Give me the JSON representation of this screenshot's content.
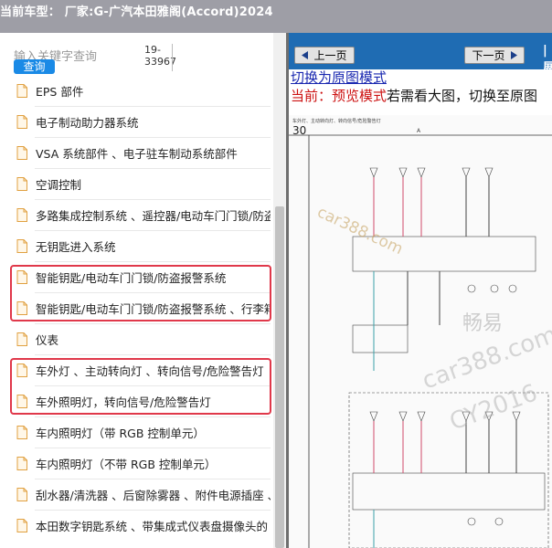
{
  "titlebar": {
    "text": "当前车型： 厂家:G-广汽本田雅阁(Accord)2024"
  },
  "search": {
    "placeholder": "输入关键字查询",
    "button": "查询",
    "code_line1": "19-",
    "code_line2": "33967"
  },
  "tree": {
    "items": [
      {
        "label": "EPS 部件"
      },
      {
        "label": "电子制动助力器系统"
      },
      {
        "label": "VSA 系统部件 、电子驻车制动系统部件"
      },
      {
        "label": "空调控制"
      },
      {
        "label": "多路集成控制系统 、遥控器/电动车门门锁/防盗"
      },
      {
        "label": "无钥匙进入系统"
      },
      {
        "label": "智能钥匙/电动车门门锁/防盗报警系统"
      },
      {
        "label": "智能钥匙/电动车门门锁/防盗报警系统 、行李箱"
      },
      {
        "label": "仪表"
      },
      {
        "label": "车外灯 、主动转向灯 、转向信号/危险警告灯"
      },
      {
        "label": "车外照明灯，转向信号/危险警告灯"
      },
      {
        "label": "车内照明灯（带 RGB 控制单元）"
      },
      {
        "label": "车内照明灯（不带 RGB 控制单元）"
      },
      {
        "label": "刮水器/清洗器 、后窗除雾器 、附件电源插座 、"
      },
      {
        "label": "本田数字钥匙系统 、带集成式仪表盘摄像头的"
      }
    ]
  },
  "nav": {
    "prev": "上一页",
    "next": "下一页",
    "edge": "|展"
  },
  "viewer": {
    "switch_link": "切换为原图模式",
    "mode_label": "当前：预览模式",
    "mode_hint": "若需看大图，切换至原图",
    "page_number": "30",
    "diagram_title": "车外灯、主动转向灯、转向信号/危险警告灯",
    "grid_letter": "A",
    "watermarks": [
      "car388.com",
      "畅易",
      "car388.com",
      "CY2016"
    ]
  },
  "colors": {
    "nav_bg": "#1f6cb3",
    "highlight": "#e0384a",
    "search_btn": "#1a8ae6",
    "link": "#1a28b0",
    "mode_red": "#cc1111"
  }
}
